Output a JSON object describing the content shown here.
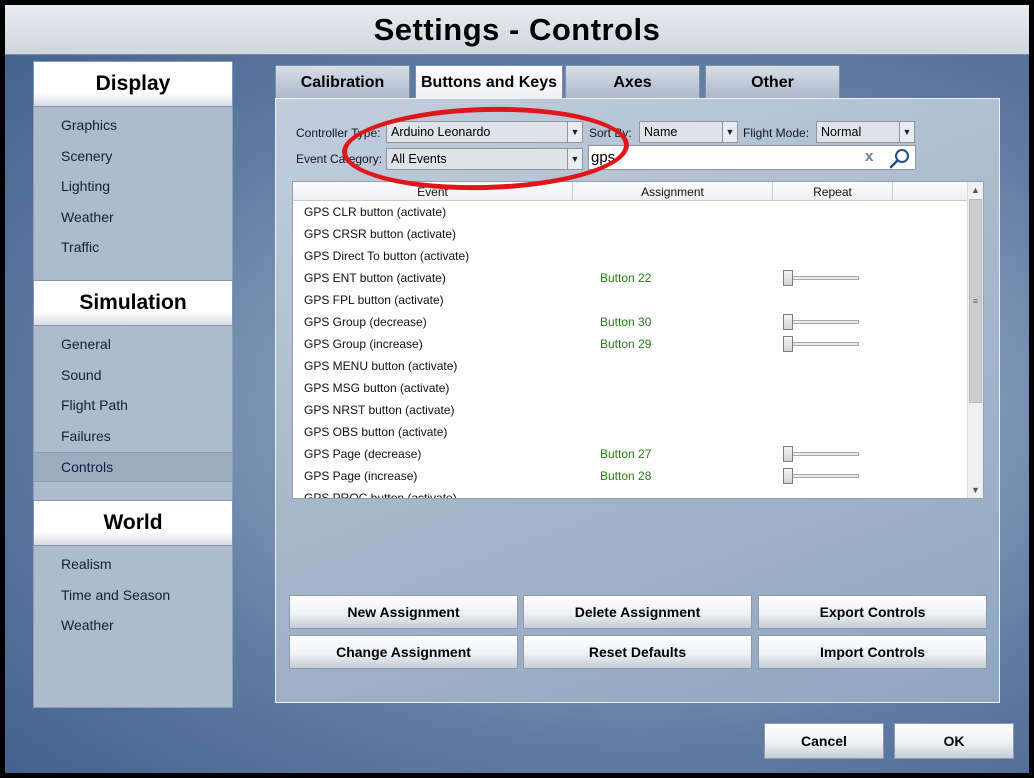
{
  "window": {
    "title": "Settings - Controls"
  },
  "sidebar": {
    "sections": [
      {
        "label": "Display",
        "items": [
          "Graphics",
          "Scenery",
          "Lighting",
          "Weather",
          "Traffic"
        ]
      },
      {
        "label": "Simulation",
        "items": [
          "General",
          "Sound",
          "Flight Path",
          "Failures",
          "Controls"
        ]
      },
      {
        "label": "World",
        "items": [
          "Realism",
          "Time and Season",
          "Weather"
        ]
      }
    ],
    "active_item": "Controls"
  },
  "tabs": [
    {
      "label": "Calibration"
    },
    {
      "label": "Buttons and Keys"
    },
    {
      "label": "Axes"
    },
    {
      "label": "Other"
    }
  ],
  "active_tab": "Buttons and Keys",
  "filters": {
    "controller_type_label": "Controller Type:",
    "controller_type_value": "Arduino Leonardo",
    "sort_by_label": "Sort By:",
    "sort_by_value": "Name",
    "flight_mode_label": "Flight Mode:",
    "flight_mode_value": "Normal",
    "event_category_label": "Event Category:",
    "event_category_value": "All Events",
    "search_value": "gps",
    "clear_label": "x"
  },
  "table": {
    "columns": [
      "Event",
      "Assignment",
      "Repeat"
    ],
    "rows": [
      {
        "event": "GPS CLR button (activate)",
        "assignment": "",
        "repeat": null
      },
      {
        "event": "GPS CRSR button (activate)",
        "assignment": "",
        "repeat": null
      },
      {
        "event": "GPS Direct To button (activate)",
        "assignment": "",
        "repeat": null
      },
      {
        "event": "GPS ENT button (activate)",
        "assignment": "Button 22",
        "repeat": 0
      },
      {
        "event": "GPS FPL button (activate)",
        "assignment": "",
        "repeat": null
      },
      {
        "event": "GPS Group (decrease)",
        "assignment": "Button 30",
        "repeat": 0
      },
      {
        "event": "GPS Group (increase)",
        "assignment": "Button 29",
        "repeat": 0
      },
      {
        "event": "GPS MENU button (activate)",
        "assignment": "",
        "repeat": null
      },
      {
        "event": "GPS MSG button (activate)",
        "assignment": "",
        "repeat": null
      },
      {
        "event": "GPS NRST button (activate)",
        "assignment": "",
        "repeat": null
      },
      {
        "event": "GPS OBS button (activate)",
        "assignment": "",
        "repeat": null
      },
      {
        "event": "GPS Page (decrease)",
        "assignment": "Button 27",
        "repeat": 0
      },
      {
        "event": "GPS Page (increase)",
        "assignment": "Button 28",
        "repeat": 0
      },
      {
        "event": "GPS PROC button (activate)",
        "assignment": "",
        "repeat": null
      }
    ]
  },
  "actions": {
    "new_assignment": "New Assignment",
    "delete_assignment": "Delete Assignment",
    "export_controls": "Export Controls",
    "change_assignment": "Change Assignment",
    "reset_defaults": "Reset Defaults",
    "import_controls": "Import Controls"
  },
  "footer": {
    "cancel": "Cancel",
    "ok": "OK"
  },
  "colors": {
    "assignment_text": "#2a7a1c",
    "annotation_ring": "#e1161b"
  },
  "icons": {
    "search": "magnifier-icon",
    "clear": "clear-x-icon",
    "dropdown": "triangle-down-icon"
  }
}
